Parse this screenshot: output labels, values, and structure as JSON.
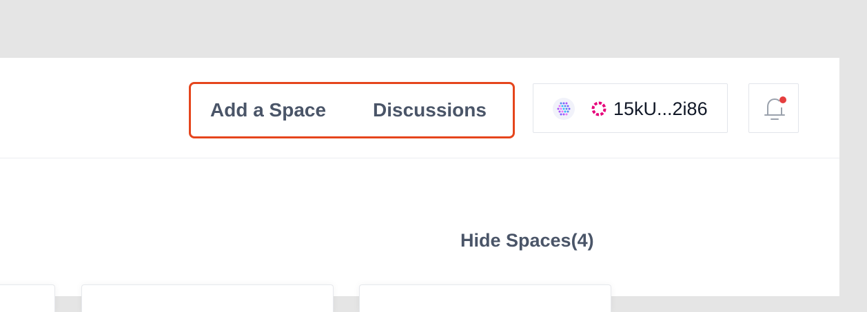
{
  "nav": {
    "add_space_label": "Add a Space",
    "discussions_label": "Discussions",
    "highlight_color": "#e5451c"
  },
  "account": {
    "address": "15kU...2i86",
    "logo_icon": "multicolor-dots-logo-icon",
    "network_icon": "polkadot-ring-icon",
    "network_color": "#e6007a"
  },
  "notifications": {
    "icon": "bell-icon",
    "has_unread": true,
    "badge_color": "#e53e3e"
  },
  "spaces": {
    "toggle_label": "Hide Spaces(4)"
  },
  "colors": {
    "nav_text": "#4a5568",
    "page_background": "#ffffff",
    "outer_background": "#e5e5e5"
  }
}
